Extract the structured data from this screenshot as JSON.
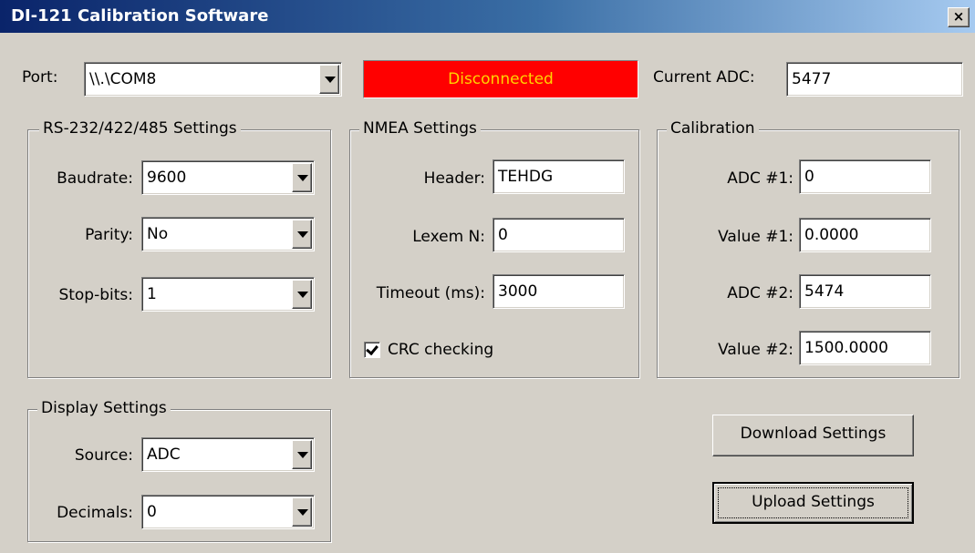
{
  "window": {
    "title": "DI-121 Calibration Software",
    "close_glyph": "×"
  },
  "port": {
    "label": "Port:",
    "value": "\\\\.\\COM8"
  },
  "connection": {
    "status": "Disconnected",
    "status_color": "#ff0000",
    "text_color": "#ffd400"
  },
  "current_adc": {
    "label": "Current ADC:",
    "value": "5477"
  },
  "serial": {
    "title": "RS-232/422/485 Settings",
    "baudrate_label": "Baudrate:",
    "baudrate": "9600",
    "parity_label": "Parity:",
    "parity": "No",
    "stopbits_label": "Stop-bits:",
    "stopbits": "1"
  },
  "nmea": {
    "title": "NMEA Settings",
    "header_label": "Header:",
    "header": "TEHDG",
    "lexem_label": "Lexem N:",
    "lexem": "0",
    "timeout_label": "Timeout (ms):",
    "timeout": "3000",
    "crc_label": "CRC checking",
    "crc_checked": true
  },
  "calibration": {
    "title": "Calibration",
    "adc1_label": "ADC #1:",
    "adc1": "0",
    "value1_label": "Value #1:",
    "value1": "0.0000",
    "adc2_label": "ADC #2:",
    "adc2": "5474",
    "value2_label": "Value #2:",
    "value2": "1500.0000"
  },
  "display": {
    "title": "Display Settings",
    "source_label": "Source:",
    "source": "ADC",
    "decimals_label": "Decimals:",
    "decimals": "0"
  },
  "buttons": {
    "download": "Download Settings",
    "upload": "Upload Settings"
  },
  "icons": {
    "dropdown": "chevron-down-icon",
    "check": "checkmark-icon"
  }
}
